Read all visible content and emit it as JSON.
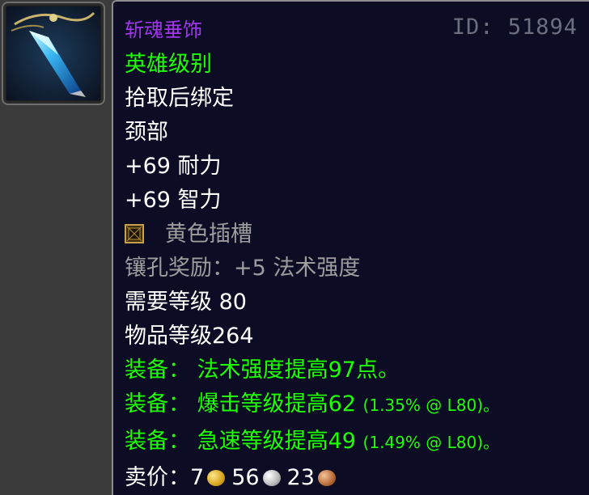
{
  "item": {
    "name": "斩魂垂饰",
    "id_label": "ID: 51894",
    "quality": "英雄级别",
    "binding": "拾取后绑定",
    "slot": "颈部",
    "stats": [
      "+69 耐力",
      "+69 智力"
    ],
    "socket": {
      "label": "黄色插槽",
      "icon": "yellow-socket-icon"
    },
    "socket_bonus": "镶孔奖励：+5 法术强度",
    "required_level": "需要等级 80",
    "item_level": "物品等级264",
    "equip": [
      {
        "text": "装备：  法术强度提高97点。",
        "note": ""
      },
      {
        "text": "装备：  爆击等级提高62",
        "note": "(1.35% @ L80)。"
      },
      {
        "text": "装备：  急速等级提高49",
        "note": "(1.49% @ L80)。"
      }
    ],
    "sell": {
      "label": "卖价：",
      "gold": "7",
      "silver": "56",
      "copper": "23"
    }
  },
  "colors": {
    "epic": "#a335ee",
    "uncommon": "#1eff00",
    "gray": "#9d9d9d",
    "background": "#0c0c24"
  },
  "icons": {
    "item_icon": "blue-crystal-pendant-icon",
    "coins": [
      "gold-coin-icon",
      "silver-coin-icon",
      "copper-coin-icon"
    ]
  }
}
